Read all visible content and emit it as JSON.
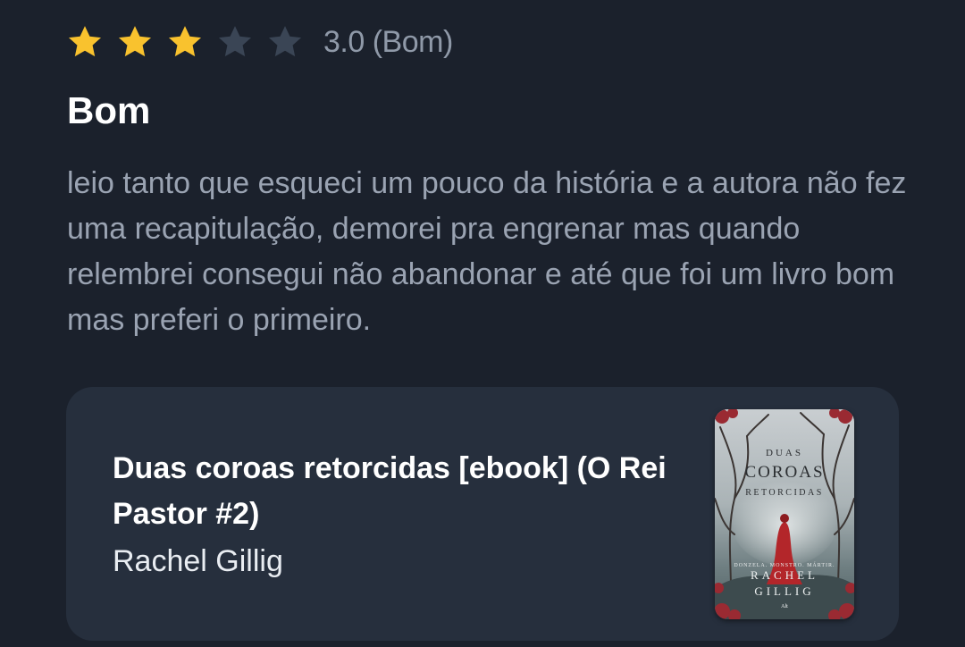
{
  "rating": {
    "value": 3,
    "max": 5,
    "label": "3.0 (Bom)",
    "filled_color": "#f9c22e",
    "empty_color": "#3a4555"
  },
  "review": {
    "title": "Bom",
    "body": "leio tanto que esqueci um pouco da história e a autora não fez uma recapitulação, demorei pra engrenar mas quando relembrei consegui não abandonar e até que foi um livro bom mas preferi o primeiro."
  },
  "book": {
    "title": "Duas coroas retorcidas [ebook] (O Rei Pastor #2)",
    "author": "Rachel Gillig",
    "cover": {
      "line1": "DUAS",
      "line2": "COROAS",
      "line3": "RETORCIDAS",
      "tagline": "DONZELA. MONSTRO. MÁRTIR.",
      "author_first": "RACHEL",
      "author_last": "GILLIG",
      "publisher": "Alt"
    }
  }
}
